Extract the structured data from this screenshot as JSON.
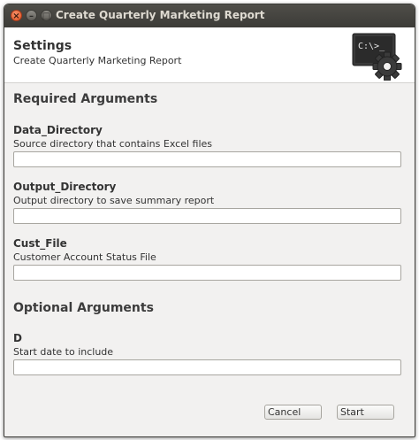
{
  "window": {
    "title": "Create Quarterly Marketing Report",
    "close_glyph": "×",
    "minimize_glyph": "–",
    "maximize_glyph": "□"
  },
  "header": {
    "title": "Settings",
    "subtitle": "Create Quarterly Marketing Report",
    "icon": "terminal-gear-icon",
    "icon_text": "C:\\>_"
  },
  "required": {
    "heading": "Required Arguments",
    "args": [
      {
        "name": "Data_Directory",
        "description": "Source directory that contains Excel files",
        "value": ""
      },
      {
        "name": "Output_Directory",
        "description": "Output directory to save summary report",
        "value": ""
      },
      {
        "name": "Cust_File",
        "description": "Customer Account Status File",
        "value": ""
      }
    ]
  },
  "optional": {
    "heading": "Optional Arguments",
    "args": [
      {
        "name": "D",
        "description": "Start date to include",
        "value": ""
      }
    ]
  },
  "buttons": {
    "cancel": "Cancel",
    "start": "Start"
  }
}
